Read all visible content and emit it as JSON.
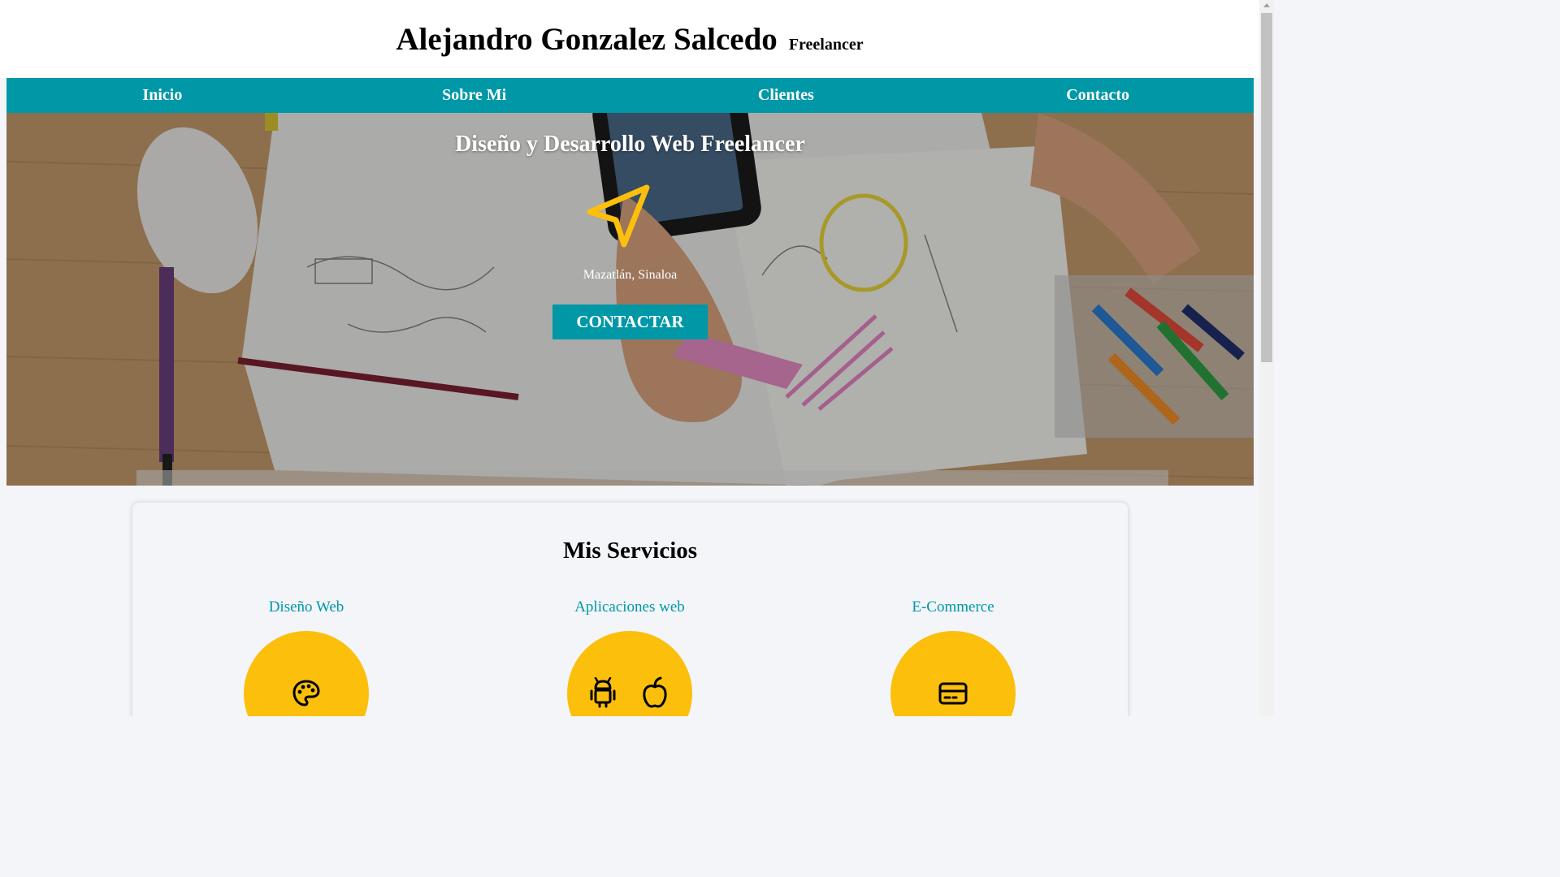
{
  "header": {
    "name": "Alejandro Gonzalez Salcedo",
    "role": "Freelancer"
  },
  "nav": {
    "items": [
      {
        "label": "Inicio"
      },
      {
        "label": "Sobre Mi"
      },
      {
        "label": "Clientes"
      },
      {
        "label": "Contacto"
      }
    ]
  },
  "hero": {
    "title": "Diseño y Desarrollo Web Freelancer",
    "icon": "navigation-arrow-icon",
    "location": "Mazatlán, Sinaloa",
    "button_label": "CONTACTAR"
  },
  "services": {
    "title": "Mis Servicios",
    "items": [
      {
        "label": "Diseño Web",
        "icon": "palette-icon"
      },
      {
        "label": "Aplicaciones web",
        "icon": "android-apple-icons"
      },
      {
        "label": "E-Commerce",
        "icon": "credit-card-icon"
      }
    ]
  },
  "colors": {
    "accent": "#0097a7",
    "yellow": "#fbbf0c",
    "background": "#f3f5f8"
  }
}
